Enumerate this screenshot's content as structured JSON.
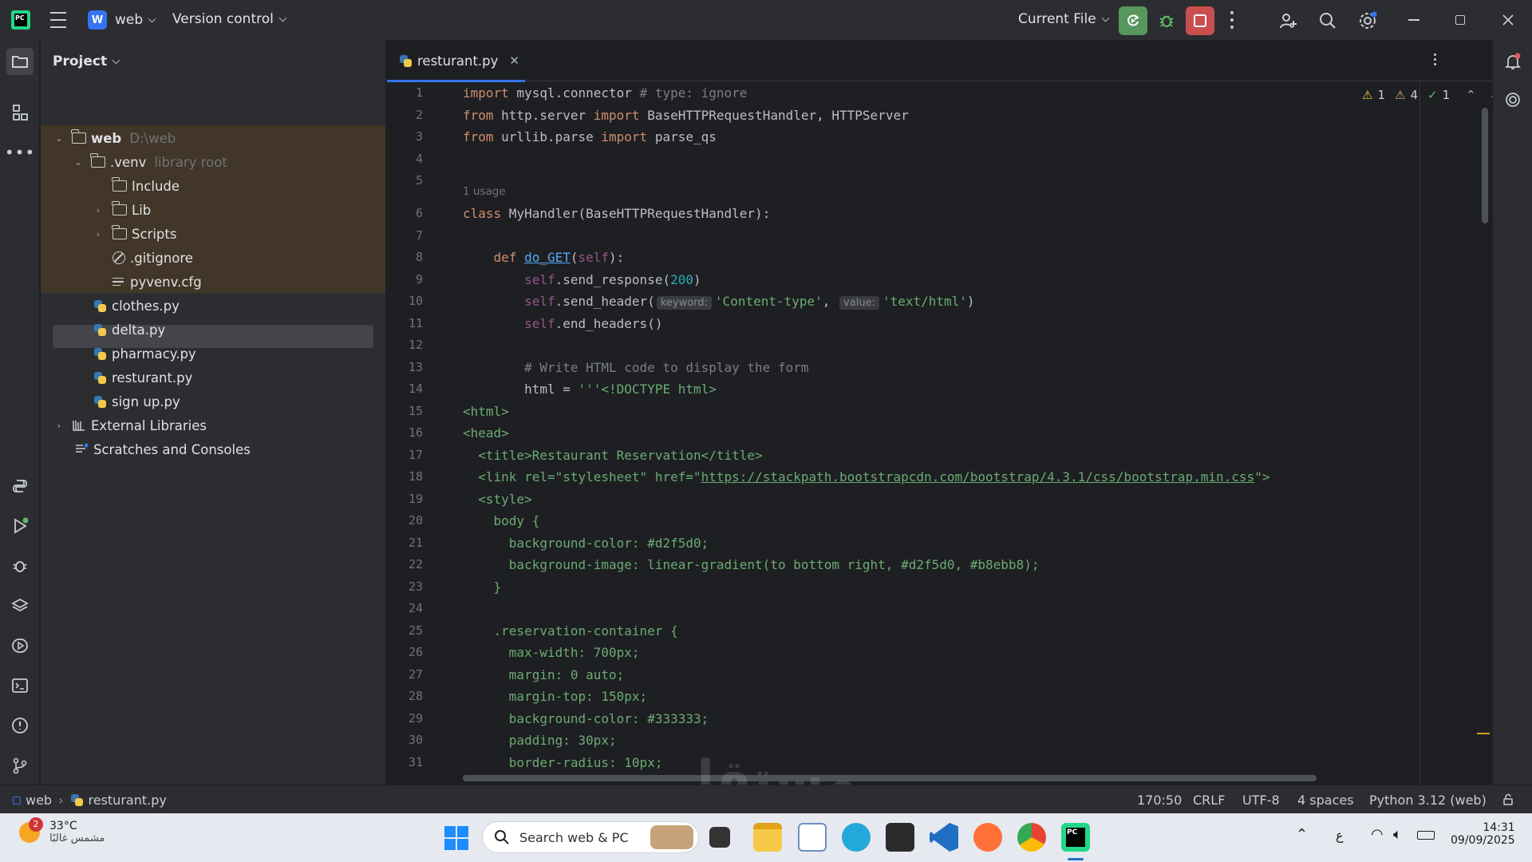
{
  "titlebar": {
    "project_badge": "W",
    "project_name": "web",
    "vcs": "Version control",
    "run_config": "Current File"
  },
  "project_panel": {
    "title": "Project",
    "tree": [
      {
        "label": "web",
        "hint": "D:\\web"
      },
      {
        "label": ".venv",
        "hint": "library root"
      },
      {
        "label": "Include"
      },
      {
        "label": "Lib"
      },
      {
        "label": "Scripts"
      },
      {
        "label": ".gitignore"
      },
      {
        "label": "pyvenv.cfg"
      },
      {
        "label": "clothes.py"
      },
      {
        "label": "delta.py"
      },
      {
        "label": "pharmacy.py"
      },
      {
        "label": "resturant.py"
      },
      {
        "label": "sign up.py"
      },
      {
        "label": "External Libraries"
      },
      {
        "label": "Scratches and Consoles"
      }
    ]
  },
  "editor": {
    "tab": "resturant.py",
    "inspections": {
      "warn_a": "1",
      "warn_b": "4",
      "ok": "1"
    },
    "usage_hint": "1 usage",
    "line_numbers": [
      "1",
      "2",
      "3",
      "4",
      "5",
      "6",
      "7",
      "8",
      "9",
      "10",
      "11",
      "12",
      "13",
      "14",
      "15",
      "16",
      "17",
      "18",
      "19",
      "20",
      "21",
      "22",
      "23",
      "24",
      "25",
      "26",
      "27",
      "28",
      "29",
      "30",
      "31"
    ],
    "param_hints": {
      "keyword": "keyword:",
      "value": "value:"
    },
    "code": {
      "l1_import": "import",
      "l1_rest": " mysql.connector",
      "l1_cmt": " # type: ignore",
      "l2_from": "from",
      "l2_mod": " http.server ",
      "l2_import": "import",
      "l2_rest": " BaseHTTPRequestHandler, HTTPServer",
      "l3_from": "from",
      "l3_mod": " urllib.parse ",
      "l3_import": "import",
      "l3_rest": " parse_qs",
      "l6_class": "class",
      "l6_rest": " MyHandler(BaseHTTPRequestHandler):",
      "l8_def": "    def ",
      "l8_fn": "do_GET",
      "l8_p1": "(",
      "l8_self": "self",
      "l8_p2": "):",
      "l9_self": "        self",
      "l9_call": ".send_response(",
      "l9_num": "200",
      "l9_end": ")",
      "l10_self": "        self",
      "l10_call": ".send_header(",
      "l10_s1": "'Content-type'",
      "l10_comma": ", ",
      "l10_s2": "'text/html'",
      "l10_end": ")",
      "l11_self": "        self",
      "l11_call": ".end_headers()",
      "l13_cmt": "        # Write HTML code to display the form",
      "l14_a": "        html = ",
      "l14_str": "'''<!DOCTYPE html>",
      "l15": "<html>",
      "l16": "<head>",
      "l17": "  <title>Restaurant Reservation</title>",
      "l18_a": "  <link rel=\"stylesheet\" href=\"",
      "l18_url": "https://stackpath.bootstrapcdn.com/bootstrap/4.3.1/css/bootstrap.min.css",
      "l18_b": "\">",
      "l19": "  <style>",
      "l20": "    body {",
      "l21": "      background-color: #d2f5d0;",
      "l22": "      background-image: linear-gradient(to bottom right, #d2f5d0, #b8ebb8);",
      "l23": "    }",
      "l25": "    .reservation-container {",
      "l26": "      max-width: 700px;",
      "l27": "      margin: 0 auto;",
      "l28": "      margin-top: 150px;",
      "l29": "      background-color: #333333;",
      "l30": "      padding: 30px;",
      "l31": "      border-radius: 10px;"
    }
  },
  "statusbar": {
    "crumb_project": "web",
    "crumb_file": "resturant.py",
    "position": "170:50",
    "line_sep": "CRLF",
    "encoding": "UTF-8",
    "indent": "4 spaces",
    "interpreter": "Python 3.12 (web)"
  },
  "taskbar": {
    "weather_temp": "33°C",
    "weather_desc": "مشمس غالبًا",
    "weather_badge": "2",
    "search_placeholder": "Search web & PC",
    "lang": "ع",
    "time": "14:31",
    "date": "09/09/2025"
  },
  "watermark": "مستقل"
}
